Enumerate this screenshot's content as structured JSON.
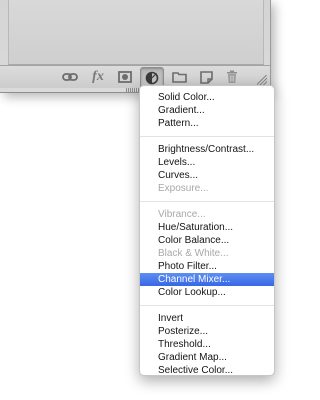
{
  "toolbar": {
    "icons": [
      {
        "name": "link-layers-icon"
      },
      {
        "name": "layer-style-fx-icon",
        "label": "fx"
      },
      {
        "name": "layer-mask-icon"
      },
      {
        "name": "adjustment-layer-icon"
      },
      {
        "name": "new-group-folder-icon"
      },
      {
        "name": "new-layer-icon"
      },
      {
        "name": "delete-layer-trash-icon"
      }
    ]
  },
  "menu": {
    "sections": [
      {
        "items": [
          {
            "label": "Solid Color...",
            "enabled": true
          },
          {
            "label": "Gradient...",
            "enabled": true
          },
          {
            "label": "Pattern...",
            "enabled": true
          }
        ]
      },
      {
        "items": [
          {
            "label": "Brightness/Contrast...",
            "enabled": true
          },
          {
            "label": "Levels...",
            "enabled": true
          },
          {
            "label": "Curves...",
            "enabled": true
          },
          {
            "label": "Exposure...",
            "enabled": false
          }
        ]
      },
      {
        "items": [
          {
            "label": "Vibrance...",
            "enabled": false
          },
          {
            "label": "Hue/Saturation...",
            "enabled": true
          },
          {
            "label": "Color Balance...",
            "enabled": true
          },
          {
            "label": "Black & White...",
            "enabled": false
          },
          {
            "label": "Photo Filter...",
            "enabled": true
          },
          {
            "label": "Channel Mixer...",
            "enabled": true,
            "selected": true
          },
          {
            "label": "Color Lookup...",
            "enabled": true
          }
        ]
      },
      {
        "items": [
          {
            "label": "Invert",
            "enabled": true
          },
          {
            "label": "Posterize...",
            "enabled": true
          },
          {
            "label": "Threshold...",
            "enabled": true
          },
          {
            "label": "Gradient Map...",
            "enabled": true
          },
          {
            "label": "Selective Color...",
            "enabled": true
          }
        ]
      }
    ]
  },
  "colors": {
    "selection": "#3f6fe8",
    "disabled_text": "#a8a8a8"
  }
}
